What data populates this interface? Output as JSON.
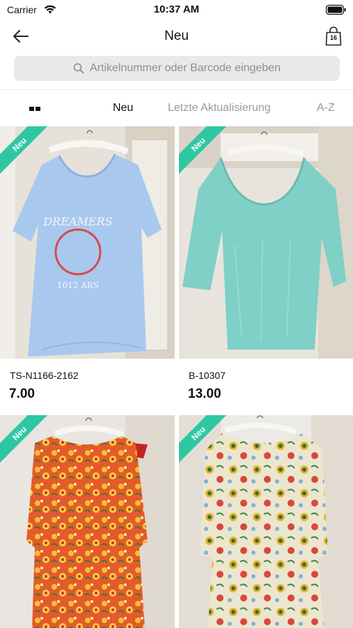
{
  "status_bar": {
    "carrier": "Carrier",
    "time": "10:37 AM"
  },
  "nav": {
    "title": "Neu",
    "cart_count": "16"
  },
  "search": {
    "placeholder": "Artikelnummer oder Barcode eingeben"
  },
  "sort_tabs": [
    {
      "label": "Neu",
      "active": true
    },
    {
      "label": "Letzte Aktualisierung",
      "active": false
    },
    {
      "label": "A-Z",
      "active": false
    }
  ],
  "products": [
    {
      "badge": "Neu",
      "sku": "TS-N1166-2162",
      "price": "7.00",
      "colors": {
        "garment": "#a9c8ee",
        "background": "#e6e2da"
      }
    },
    {
      "badge": "Neu",
      "sku": "B-10307",
      "price": "13.00",
      "colors": {
        "garment": "#7fd0c6",
        "background": "#e8e4dd"
      }
    },
    {
      "badge": "Neu",
      "sku": "",
      "price": "",
      "colors": {
        "garment": "#e55a2b",
        "background": "#e9e6e1"
      }
    },
    {
      "badge": "Neu",
      "sku": "",
      "price": "",
      "colors": {
        "garment": "#ece6cf",
        "background": "#eceae6"
      }
    }
  ],
  "colors": {
    "accent": "#2fc7a3",
    "search_bg": "#e9e9eb",
    "placeholder": "#8e8e93",
    "inactive_tab": "#9a9a9a"
  }
}
